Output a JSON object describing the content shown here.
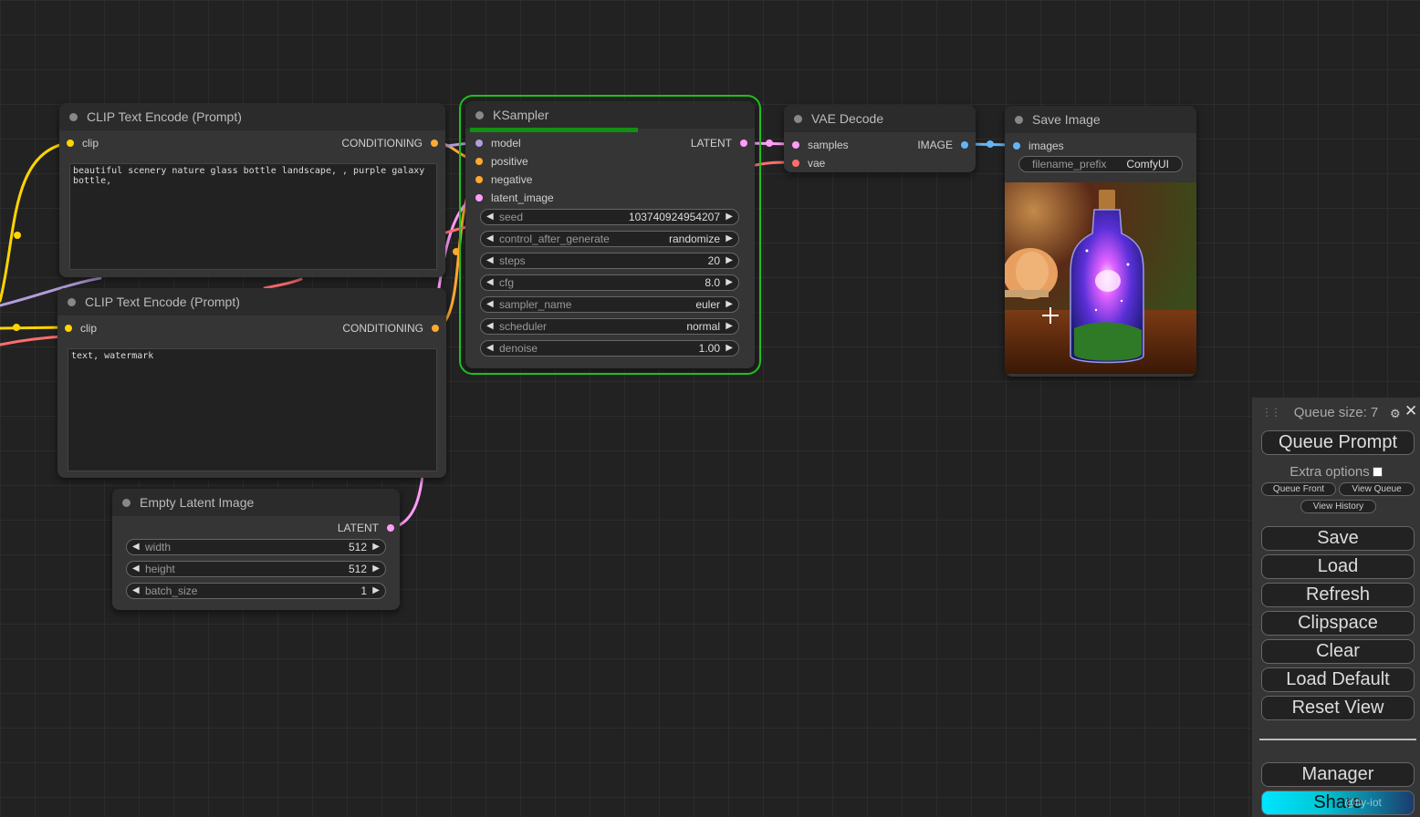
{
  "nodes": {
    "clip_pos": {
      "title": "CLIP Text Encode (Prompt)",
      "input": "clip",
      "output": "CONDITIONING",
      "text": "beautiful scenery nature glass bottle landscape, , purple galaxy bottle,"
    },
    "clip_neg": {
      "title": "CLIP Text Encode (Prompt)",
      "input": "clip",
      "output": "CONDITIONING",
      "text": "text, watermark"
    },
    "ksampler": {
      "title": "KSampler",
      "inputs": [
        "model",
        "positive",
        "negative",
        "latent_image"
      ],
      "output": "LATENT",
      "progress": 0.6,
      "widgets": [
        {
          "label": "seed",
          "value": "103740924954207"
        },
        {
          "label": "control_after_generate",
          "value": "randomize"
        },
        {
          "label": "steps",
          "value": "20"
        },
        {
          "label": "cfg",
          "value": "8.0"
        },
        {
          "label": "sampler_name",
          "value": "euler"
        },
        {
          "label": "scheduler",
          "value": "normal"
        },
        {
          "label": "denoise",
          "value": "1.00"
        }
      ]
    },
    "vae_decode": {
      "title": "VAE Decode",
      "inputs": [
        "samples",
        "vae"
      ],
      "output": "IMAGE"
    },
    "save_image": {
      "title": "Save Image",
      "input": "images",
      "widget": {
        "label": "filename_prefix",
        "value": "ComfyUI"
      }
    },
    "empty_latent": {
      "title": "Empty Latent Image",
      "output": "LATENT",
      "widgets": [
        {
          "label": "width",
          "value": "512"
        },
        {
          "label": "height",
          "value": "512"
        },
        {
          "label": "batch_size",
          "value": "1"
        }
      ]
    }
  },
  "menu": {
    "queue_size": "Queue size: 7",
    "queue_prompt": "Queue Prompt",
    "extra_options": "Extra options",
    "queue_front": "Queue Front",
    "view_queue": "View Queue",
    "view_history": "View History",
    "save": "Save",
    "load": "Load",
    "refresh": "Refresh",
    "clipspace": "Clipspace",
    "clear": "Clear",
    "load_default": "Load Default",
    "reset_view": "Reset View",
    "manager": "Manager",
    "share": "Share"
  },
  "watermark": "@fly-iot",
  "colors": {
    "clip": "#ffd500",
    "conditioning": "#ffa931",
    "model": "#b39ddb",
    "latent": "#ff9cf9",
    "vae": "#ff6e6e",
    "image": "#64b5f6",
    "running_outline": "#1fbf1f"
  }
}
